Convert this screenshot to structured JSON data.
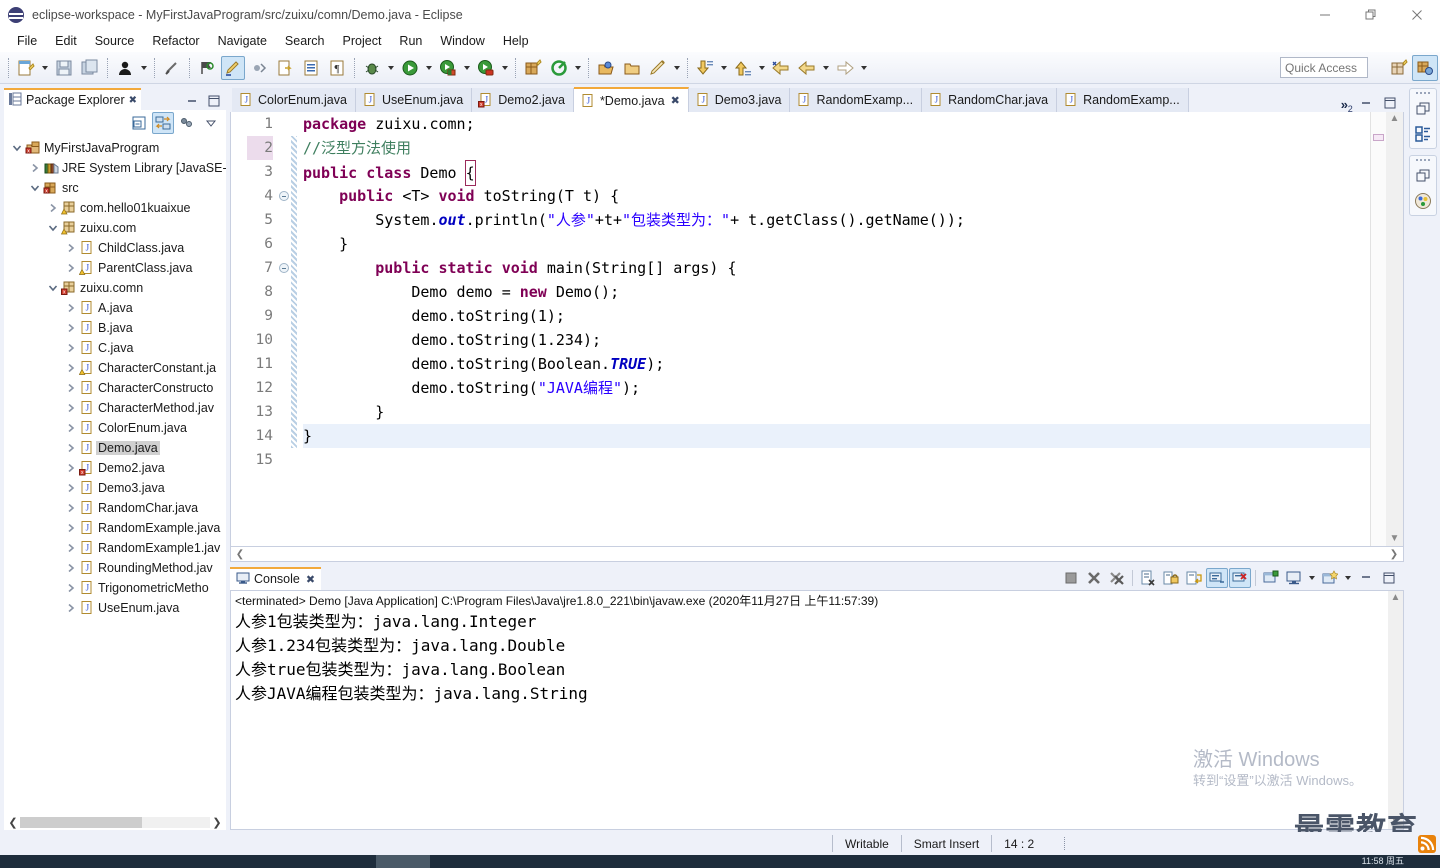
{
  "window": {
    "title": "eclipse-workspace - MyFirstJavaProgram/src/zuixu/comn/Demo.java - Eclipse",
    "minimize_label": "—",
    "maximize_label": "❐",
    "close_label": "✕"
  },
  "menubar": {
    "items": [
      "File",
      "Edit",
      "Source",
      "Refactor",
      "Navigate",
      "Search",
      "Project",
      "Run",
      "Window",
      "Help"
    ]
  },
  "toolbar": {
    "quick_access_placeholder": "Quick Access",
    "quick_access_value": "",
    "icons": [
      "new-wizard-icon",
      "save-icon",
      "save-all-icon",
      "person-icon",
      "link-off-icon",
      "toggle-mark-occurrences-icon",
      "highlight-icon",
      "skip-breakpoints-icon",
      "open-type-icon",
      "properties-icon",
      "pilcrow-icon",
      "debug-icon",
      "run-icon",
      "run-last-tool-icon",
      "external-tools-icon",
      "new-java-project-icon",
      "search-icon",
      "open-task-icon",
      "open-folder-icon",
      "pencil-icon",
      "next-annotation-icon",
      "previous-annotation-icon",
      "back-icon",
      "forward-left-icon",
      "forward-icon"
    ],
    "perspective_icons": [
      "new-perspective-icon",
      "java-perspective-icon"
    ]
  },
  "package_explorer": {
    "tab_label": "Package Explorer",
    "close_label": "✖",
    "toolbar_icons": [
      "collapse-all-icon",
      "link-with-editor-icon",
      "view-menu-icon",
      "view-menu-chevron-icon"
    ],
    "minimize_label": "—",
    "maximize_label": "❐",
    "tree": [
      {
        "label": "MyFirstJavaProgram",
        "depth": 0,
        "twisty": "down",
        "icon": "java-project-icon",
        "selected": false
      },
      {
        "label": "JRE System Library [JavaSE-",
        "depth": 1,
        "twisty": "right",
        "icon": "library-icon",
        "selected": false
      },
      {
        "label": "src",
        "depth": 1,
        "twisty": "down",
        "icon": "source-folder-icon",
        "selected": false
      },
      {
        "label": "com.hello01kuaixue",
        "depth": 2,
        "twisty": "right",
        "icon": "package-warn-icon",
        "selected": false
      },
      {
        "label": "zuixu.com",
        "depth": 2,
        "twisty": "down",
        "icon": "package-warn-icon",
        "selected": false
      },
      {
        "label": "ChildClass.java",
        "depth": 3,
        "twisty": "right",
        "icon": "java-file-icon",
        "selected": false
      },
      {
        "label": "ParentClass.java",
        "depth": 3,
        "twisty": "right",
        "icon": "java-file-warn-icon",
        "selected": false
      },
      {
        "label": "zuixu.comn",
        "depth": 2,
        "twisty": "down",
        "icon": "package-error-icon",
        "selected": false
      },
      {
        "label": "A.java",
        "depth": 3,
        "twisty": "right",
        "icon": "java-file-icon",
        "selected": false
      },
      {
        "label": "B.java",
        "depth": 3,
        "twisty": "right",
        "icon": "java-file-icon",
        "selected": false
      },
      {
        "label": "C.java",
        "depth": 3,
        "twisty": "right",
        "icon": "java-file-icon",
        "selected": false
      },
      {
        "label": "CharacterConstant.ja",
        "depth": 3,
        "twisty": "right",
        "icon": "java-file-warn-icon",
        "selected": false
      },
      {
        "label": "CharacterConstructo",
        "depth": 3,
        "twisty": "right",
        "icon": "java-file-icon",
        "selected": false
      },
      {
        "label": "CharacterMethod.jav",
        "depth": 3,
        "twisty": "right",
        "icon": "java-file-icon",
        "selected": false
      },
      {
        "label": "ColorEnum.java",
        "depth": 3,
        "twisty": "right",
        "icon": "java-file-icon",
        "selected": false
      },
      {
        "label": "Demo.java",
        "depth": 3,
        "twisty": "right",
        "icon": "java-file-icon",
        "selected": true
      },
      {
        "label": "Demo2.java",
        "depth": 3,
        "twisty": "right",
        "icon": "java-file-error-icon",
        "selected": false
      },
      {
        "label": "Demo3.java",
        "depth": 3,
        "twisty": "right",
        "icon": "java-file-icon",
        "selected": false
      },
      {
        "label": "RandomChar.java",
        "depth": 3,
        "twisty": "right",
        "icon": "java-file-icon",
        "selected": false
      },
      {
        "label": "RandomExample.java",
        "depth": 3,
        "twisty": "right",
        "icon": "java-file-icon",
        "selected": false
      },
      {
        "label": "RandomExample1.jav",
        "depth": 3,
        "twisty": "right",
        "icon": "java-file-icon",
        "selected": false
      },
      {
        "label": "RoundingMethod.jav",
        "depth": 3,
        "twisty": "right",
        "icon": "java-file-icon",
        "selected": false
      },
      {
        "label": "TrigonometricMetho",
        "depth": 3,
        "twisty": "right",
        "icon": "java-file-icon",
        "selected": false
      },
      {
        "label": "UseEnum.java",
        "depth": 3,
        "twisty": "right",
        "icon": "java-file-icon",
        "selected": false
      }
    ]
  },
  "editor": {
    "tabs": [
      {
        "label": "ColorEnum.java",
        "icon": "java-file-icon",
        "active": false,
        "dirty": false
      },
      {
        "label": "UseEnum.java",
        "icon": "java-file-icon",
        "active": false,
        "dirty": false
      },
      {
        "label": "Demo2.java",
        "icon": "java-file-error-icon",
        "active": false,
        "dirty": false
      },
      {
        "label": "*Demo.java",
        "icon": "java-file-icon",
        "active": true,
        "dirty": true
      },
      {
        "label": "Demo3.java",
        "icon": "java-file-icon",
        "active": false,
        "dirty": false
      },
      {
        "label": "RandomExamp...",
        "icon": "java-file-icon",
        "active": false,
        "dirty": false
      },
      {
        "label": "RandomChar.java",
        "icon": "java-file-icon",
        "active": false,
        "dirty": false
      },
      {
        "label": "RandomExamp...",
        "icon": "java-file-icon",
        "active": false,
        "dirty": false
      }
    ],
    "overflow_count": "2",
    "overflow_chevron": "»",
    "close_label": "✖",
    "minimize_label": "—",
    "maximize_label": "❐",
    "line_numbers": [
      "1",
      "2",
      "3",
      "4",
      "5",
      "6",
      "7",
      "8",
      "9",
      "10",
      "11",
      "12",
      "13",
      "14",
      "15"
    ],
    "code_lines": [
      "package zuixu.comn;",
      "//泛型方法使用",
      "public class Demo {",
      "    public <T> void toString(T t) {",
      "        System.out.println(\"人参\"+t+\"包装类型为：\"+ t.getClass().getName());",
      "    }",
      "        public static void main(String[] args) {",
      "            Demo demo = new Demo();",
      "            demo.toString(1);",
      "            demo.toString(1.234);",
      "            demo.toString(Boolean.TRUE);",
      "            demo.toString(\"JAVA编程\");",
      "        }",
      "}",
      ""
    ],
    "fold_lines": [
      "4",
      "7"
    ],
    "current_line": "14",
    "highlighted_number_line": "2"
  },
  "console": {
    "tab_label": "Console",
    "close_label": "✖",
    "terminated_line": "<terminated> Demo [Java Application] C:\\Program Files\\Java\\jre1.8.0_221\\bin\\javaw.exe (2020年11月27日 上午11:57:39)",
    "output_lines": [
      "人参1包装类型为：java.lang.Integer",
      "人参1.234包装类型为：java.lang.Double",
      "人参true包装类型为：java.lang.Boolean",
      "人参JAVA编程包装类型为：java.lang.String"
    ],
    "toolbar_icons": [
      "terminate-icon",
      "remove-launch-icon",
      "remove-all-terminated-icon",
      "clear-console-icon",
      "scroll-lock-icon",
      "word-wrap-icon",
      "show-console-on-output-icon",
      "show-console-on-error-icon",
      "pin-console-icon",
      "display-selected-console-icon",
      "display-console-chevron-icon",
      "open-console-icon",
      "open-console-chevron-icon"
    ],
    "minimize_label": "—",
    "maximize_label": "❐"
  },
  "fast_view": {
    "groups": [
      {
        "icons": [
          "restore-icon",
          "outline-icon"
        ]
      },
      {
        "icons": [
          "restore-icon",
          "palette-icon"
        ]
      }
    ]
  },
  "statusbar": {
    "writable": "Writable",
    "insert_mode": "Smart Insert",
    "position": "14 : 2",
    "rss_icon": "rss-icon"
  },
  "watermark": {
    "activate_title": "激活 Windows",
    "activate_sub": "转到“设置”以激活 Windows。",
    "brand": "最需教育"
  },
  "taskbar": {
    "time": "11:58 周五"
  },
  "colors": {
    "accent_tab": "#f2a93b",
    "selection_blue": "#cfe5f7",
    "keyword": "#7f0055",
    "string": "#2a00ff",
    "comment": "#3f7f5f",
    "static_field": "#0000c0",
    "current_line": "#eaf1fb",
    "panel_bg": "#eef1f9"
  }
}
